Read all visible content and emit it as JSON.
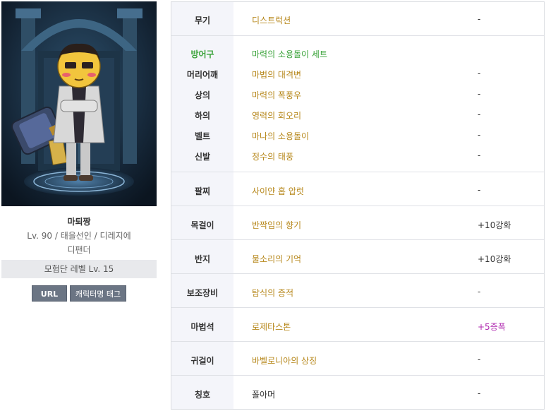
{
  "character": {
    "name": "마퇴짱",
    "info_line1": "Lv. 90 / 태을선인 / 디레지에",
    "info_line2": "디팬더",
    "guild_level": "모험단 레벨 Lv. 15"
  },
  "buttons": {
    "url": "URL",
    "tag": "캐릭터명 태그"
  },
  "equipment": [
    {
      "category": "무기",
      "item": "디스트럭션",
      "value": "-"
    },
    {
      "category": "방어구",
      "item": "마력의 소용돌이 세트",
      "value": ""
    },
    {
      "category": "머리어깨",
      "item": "마법의 대격변",
      "value": "-"
    },
    {
      "category": "상의",
      "item": "마력의 폭풍우",
      "value": "-"
    },
    {
      "category": "하의",
      "item": "영력의 회오리",
      "value": "-"
    },
    {
      "category": "벨트",
      "item": "마나의 소용돌이",
      "value": "-"
    },
    {
      "category": "신발",
      "item": "정수의 태풍",
      "value": "-"
    },
    {
      "category": "팔찌",
      "item": "사이얀 홉 압럿",
      "value": "-"
    },
    {
      "category": "목걸이",
      "item": "반짝임의 향기",
      "value": "+10강화"
    },
    {
      "category": "반지",
      "item": "물소리의 기억",
      "value": "+10강화"
    },
    {
      "category": "보조장비",
      "item": "탐식의 증적",
      "value": "-"
    },
    {
      "category": "마법석",
      "item": "로제타스톤",
      "value": "+5증폭"
    },
    {
      "category": "귀걸이",
      "item": "바벨로니아의 상징",
      "value": "-"
    },
    {
      "category": "칭호",
      "item": "폴아머",
      "value": "-"
    }
  ],
  "colors": {
    "item_gold": "#b7881c",
    "set_green": "#3aa33a",
    "amplify_purple": "#b02bb0",
    "category_bg": "#f4f5fa"
  }
}
